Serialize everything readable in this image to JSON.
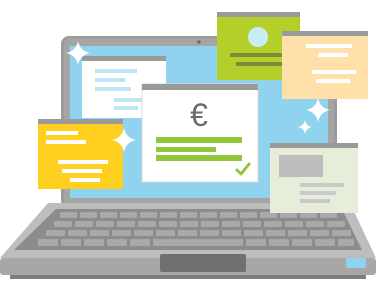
{
  "illustration": {
    "currency_symbol": "€",
    "icons": {
      "payment_check": "checkmark-icon",
      "sparkle": "sparkle-icon",
      "avatar": "avatar-icon"
    },
    "colors": {
      "screen": "#8fd3ee",
      "laptop_body": "#8c8c8c",
      "laptop_light": "#bdbdbd",
      "laptop_dark": "#5e5e5e",
      "key": "#a9a9a9",
      "accent_green": "#8fc63a",
      "card_yellow": "#ffcf1f",
      "card_lime": "#b5cf2a",
      "card_peach": "#ffe0a9",
      "card_pale": "#e6edd9",
      "titlebar": "#9a9a9a"
    }
  }
}
